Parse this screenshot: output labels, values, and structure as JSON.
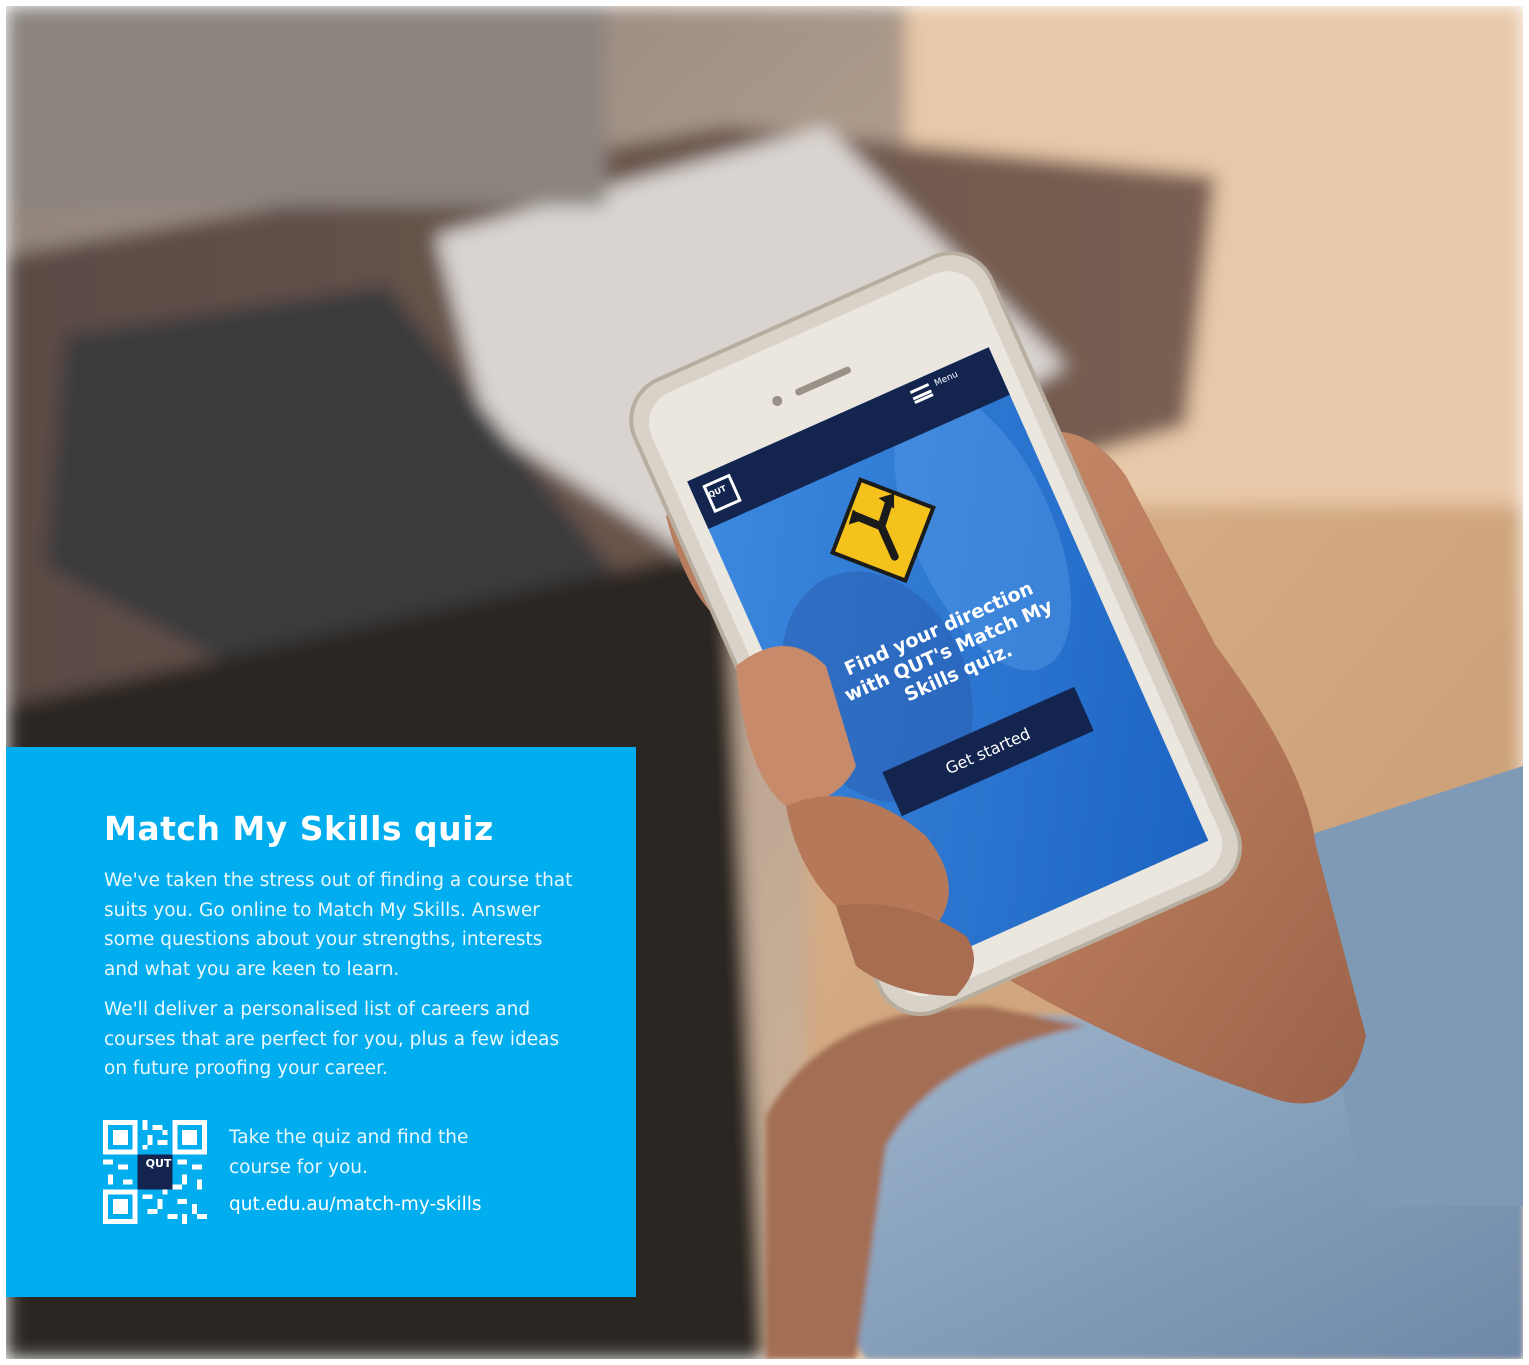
{
  "phone_screen": {
    "menu_label": "Menu",
    "logo_text": "QUT",
    "headline_lines": [
      "Find your direction",
      "with QUT's Match My",
      "Skills quiz."
    ],
    "button_label": "Get started"
  },
  "promo": {
    "title": "Match My Skills quiz",
    "paragraph_1": "We've taken the stress out of finding a course that suits you. Go online to Match My Skills. Answer some questions about your strengths, interests and what you are keen to learn.",
    "paragraph_2": "We'll deliver a personalised list of careers and courses that are perfect for you, plus a few ideas on future proofing your career.",
    "qr_logo_text": "QUT",
    "cta_text": "Take the quiz and find the course for you.",
    "url": "qut.edu.au/match-my-skills"
  },
  "colors": {
    "panel_blue": "#00aeef",
    "qut_navy": "#13254f",
    "screen_blue": "#2f7fd6",
    "sign_yellow": "#f5c21b"
  },
  "icons": [
    "hamburger-menu-icon",
    "road-fork-arrow-sign-icon",
    "qr-code-icon"
  ]
}
